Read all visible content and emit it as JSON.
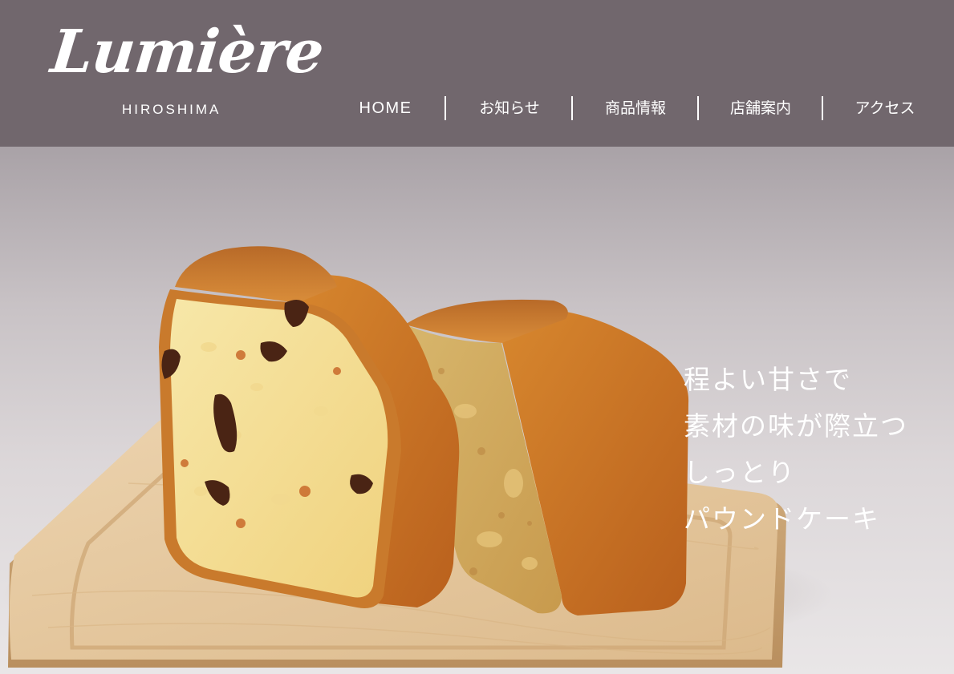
{
  "brand": {
    "name": "Lumière",
    "location": "HIROSHIMA"
  },
  "nav": {
    "items": [
      {
        "label": "HOME",
        "active": true
      },
      {
        "label": "お知らせ"
      },
      {
        "label": "商品情報"
      },
      {
        "label": "店舗案内"
      },
      {
        "label": "アクセス"
      }
    ]
  },
  "hero": {
    "lines": [
      "程よい甘さで",
      "素材の味が際立つ",
      "しっとり",
      "パウンドケーキ"
    ]
  },
  "colors": {
    "header_bg": "#71676d",
    "nav_text": "#ffffff",
    "hero_text": "#ffffff"
  }
}
